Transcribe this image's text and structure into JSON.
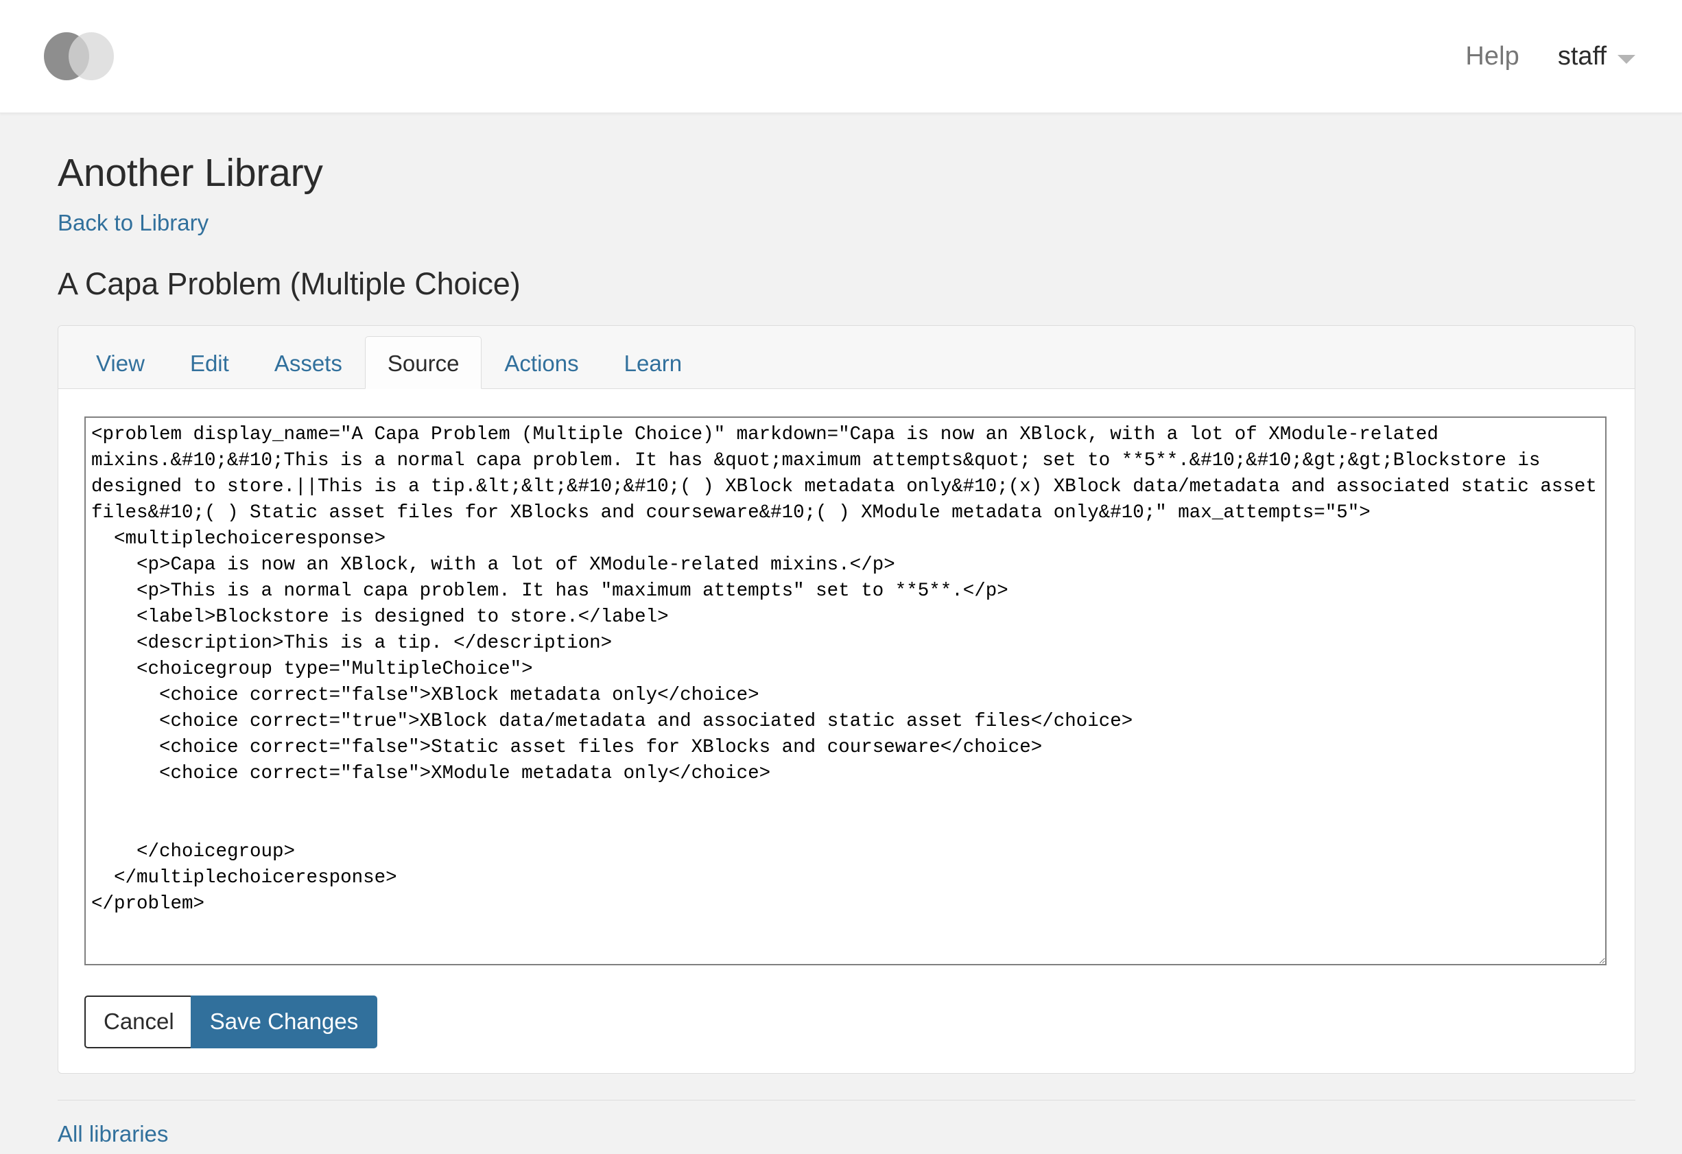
{
  "header": {
    "logo_icon": "two-overlapping-circles-logo",
    "help_label": "Help",
    "user_label": "staff",
    "caret_icon": "chevron-down-icon"
  },
  "page": {
    "library_title": "Another Library",
    "back_link_label": "Back to Library",
    "block_title": "A Capa Problem (Multiple Choice)"
  },
  "tabs": [
    {
      "label": "View",
      "active": false
    },
    {
      "label": "Edit",
      "active": false
    },
    {
      "label": "Assets",
      "active": false
    },
    {
      "label": "Source",
      "active": true
    },
    {
      "label": "Actions",
      "active": false
    },
    {
      "label": "Learn",
      "active": false
    }
  ],
  "editor": {
    "value": "<problem display_name=\"A Capa Problem (Multiple Choice)\" markdown=\"Capa is now an XBlock, with a lot of XModule-related mixins.&#10;&#10;This is a normal capa problem. It has &quot;maximum attempts&quot; set to **5**.&#10;&#10;&gt;&gt;Blockstore is designed to store.||This is a tip.&lt;&lt;&#10;&#10;( ) XBlock metadata only&#10;(x) XBlock data/metadata and associated static asset files&#10;( ) Static asset files for XBlocks and courseware&#10;( ) XModule metadata only&#10;\" max_attempts=\"5\">\n  <multiplechoiceresponse>\n    <p>Capa is now an XBlock, with a lot of XModule-related mixins.</p>\n    <p>This is a normal capa problem. It has \"maximum attempts\" set to **5**.</p>\n    <label>Blockstore is designed to store.</label>\n    <description>This is a tip. </description>\n    <choicegroup type=\"MultipleChoice\">\n      <choice correct=\"false\">XBlock metadata only</choice>\n      <choice correct=\"true\">XBlock data/metadata and associated static asset files</choice>\n      <choice correct=\"false\">Static asset files for XBlocks and courseware</choice>\n      <choice correct=\"false\">XModule metadata only</choice>\n\n\n    </choicegroup>\n  </multiplechoiceresponse>\n</problem>",
    "resize_handle_icon": "resize-grip-icon"
  },
  "buttons": {
    "cancel_label": "Cancel",
    "save_label": "Save Changes",
    "save_color": "#31709c"
  },
  "footer": {
    "all_libraries_label": "All libraries"
  },
  "colors": {
    "link": "#31709c",
    "page_bg": "#f2f2f2",
    "panel_bg": "#ffffff",
    "tabbar_bg": "#f7f7f7",
    "text": "#2b2b2b",
    "muted": "#767676",
    "spellcheck_underline": "#f07a6a"
  }
}
